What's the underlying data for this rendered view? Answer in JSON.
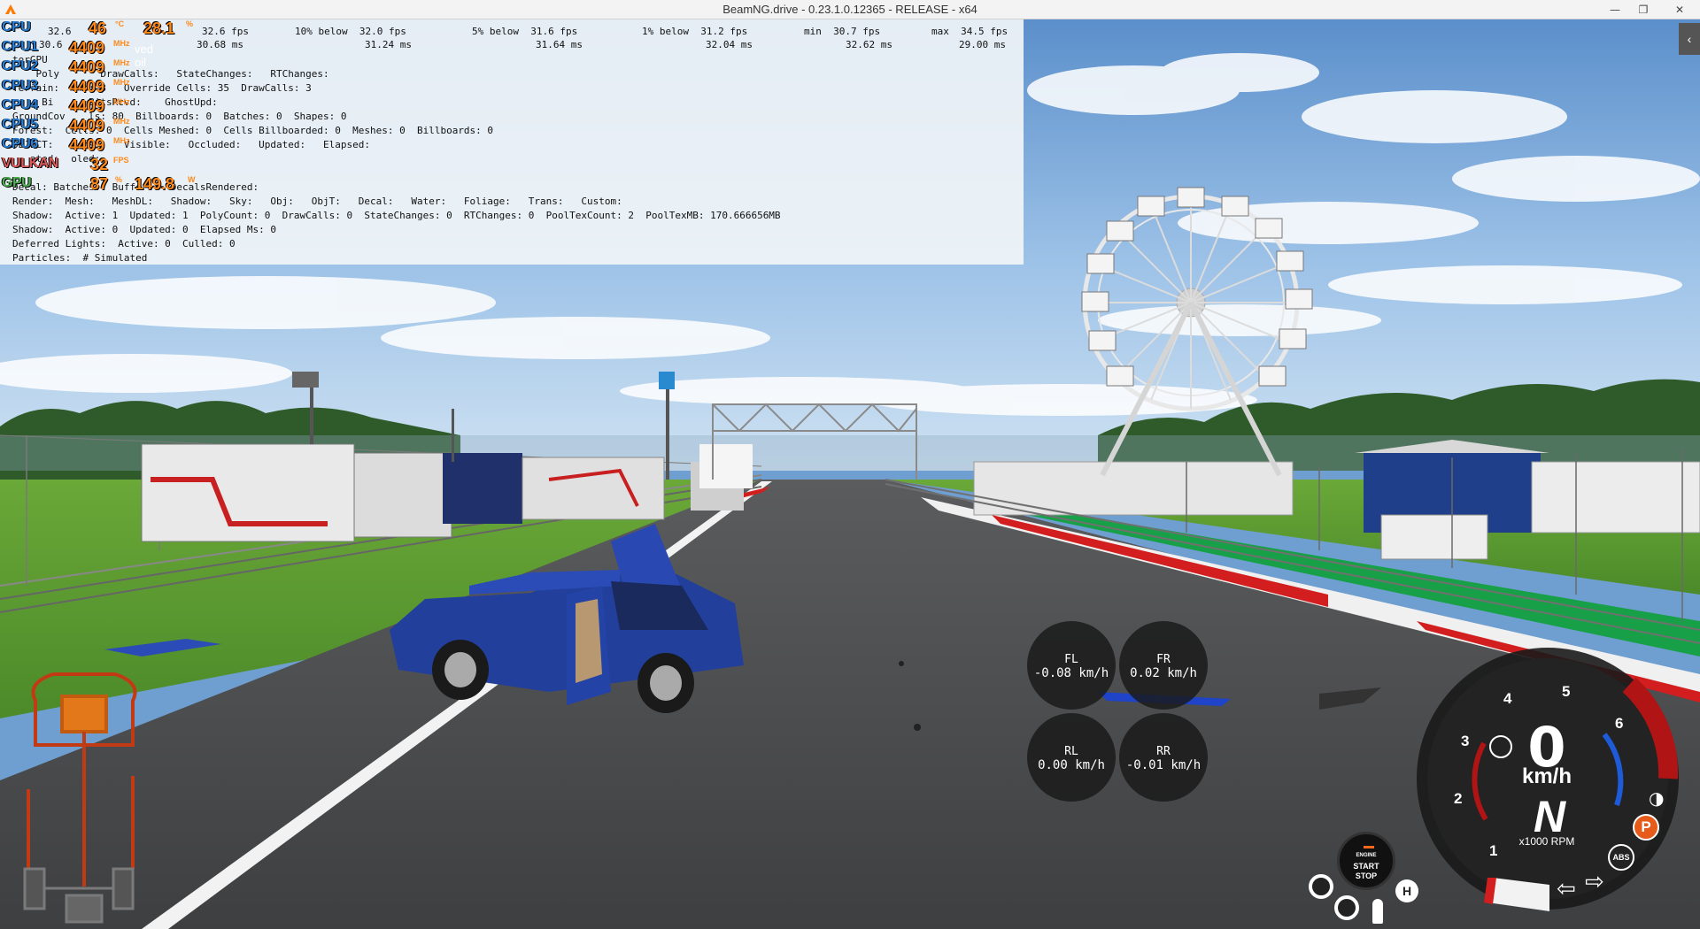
{
  "window": {
    "title": "BeamNG.drive - 0.23.1.0.12365 - RELEASE - x64",
    "minimize": "—",
    "restore": "❐",
    "close": "✕"
  },
  "fps_stats": {
    "c0": "32.6",
    "c0b": "30.6",
    "c1": "32.6 fps",
    "c1b": "30.68 ms",
    "c2": "10% below  32.0 fps",
    "c2b": "31.24 ms",
    "c3": "5% below  31.6 fps",
    "c3b": "31.64 ms",
    "c4": "1% below  31.2 fps",
    "c4b": "32.04 ms",
    "c5": "min  30.7 fps",
    "c5b": "32.62 ms",
    "c6": "max  34.5 fps",
    "c6b": "29.00 ms"
  },
  "debug_lines": [
    "torGPU",
    "    Poly       DrawCalls:   StateChanges:   RTChanges:",
    "Terrain:    s: 3   Override Cells: 35  DrawCalls: 3",
    "     Bi      BitsRcvd:    GhostUpd:",
    "GroundCov    ls: 80  Billboards: 0  Batches: 0  Shapes: 0",
    "Forest:  Cells: 0  Cells Meshed: 0  Cells Billboarded: 0  Meshes: 0  Billboards: 0",
    "OBJECT:   ects:    Visible:   Occluded:   Updated:   Elapsed:",
    "   ated:  oled:",
    "",
    "Decal: Batches:  Buffers:  DecalsRendered:",
    "Render:  Mesh:   MeshDL:   Shadow:   Sky:   Obj:   ObjT:   Decal:   Water:   Foliage:   Trans:   Custom:",
    "Shadow:  Active: 1  Updated: 1  PolyCount: 0  DrawCalls: 0  StateChanges: 0  RTChanges: 0  PoolTexCount: 2  PoolTexMB: 170.666656MB",
    "Shadow:  Active: 0  Updated: 0  Elapsed Ms: 0",
    "Deferred Lights:  Active: 0  Culled: 0",
    "Particles:  # Simulated"
  ],
  "afterburner": {
    "rows": [
      {
        "label": "CPU",
        "v1": "46",
        "u1": "°C",
        "v2": "28.1",
        "u2": "%"
      },
      {
        "label": "CPU1",
        "v1": "4409",
        "u1": "MHz",
        "v2": "",
        "u2": ""
      },
      {
        "label": "CPU2",
        "v1": "4409",
        "u1": "MHz",
        "v2": "",
        "u2": ""
      },
      {
        "label": "CPU3",
        "v1": "4409",
        "u1": "MHz",
        "v2": "",
        "u2": ""
      },
      {
        "label": "CPU4",
        "v1": "4409",
        "u1": "MHz",
        "v2": "",
        "u2": ""
      },
      {
        "label": "CPU5",
        "v1": "4409",
        "u1": "MHz",
        "v2": "",
        "u2": ""
      },
      {
        "label": "CPU6",
        "v1": "4409",
        "u1": "MHz",
        "v2": "",
        "u2": ""
      },
      {
        "label": "VULKAN",
        "v1": "32",
        "u1": "FPS",
        "v2": "",
        "u2": ""
      },
      {
        "label": "GPU",
        "v1": "87",
        "u1": "%",
        "v2": "149.8",
        "u2": "W"
      }
    ],
    "faded_text": "ved oil"
  },
  "wheels": {
    "fl": {
      "name": "FL",
      "speed": "-0.08 km/h"
    },
    "fr": {
      "name": "FR",
      "speed": "0.02 km/h"
    },
    "rl": {
      "name": "RL",
      "speed": "0.00 km/h"
    },
    "rr": {
      "name": "RR",
      "speed": "-0.01 km/h"
    }
  },
  "dashboard": {
    "speed": "0",
    "speed_unit": "km/h",
    "gear": "N",
    "rpm_label": "x1000 RPM",
    "ticks": [
      "1",
      "2",
      "3",
      "4",
      "5",
      "6"
    ],
    "parking_label": "P",
    "abs_label": "ABS",
    "hold_label": "H",
    "engine_button": {
      "line1": "ENGINE",
      "line2": "START",
      "line3": "STOP"
    },
    "redline_color": "#b01414",
    "blue_arc_color": "#1e5bd8"
  },
  "colors": {
    "sky_top": "#5f8fc8",
    "grass": "#5a9a32",
    "asphalt": "#4a4a4c",
    "pickup": "#1e3aa0",
    "curb_red": "#d21e1e",
    "curb_green": "#18a048"
  },
  "icons": [
    "app-icon",
    "drivetrain-icon",
    "tire-icon",
    "steering-icon",
    "headlight-icon",
    "arrow-left-icon",
    "arrow-right-icon",
    "parking-brake-icon",
    "abs-icon"
  ]
}
